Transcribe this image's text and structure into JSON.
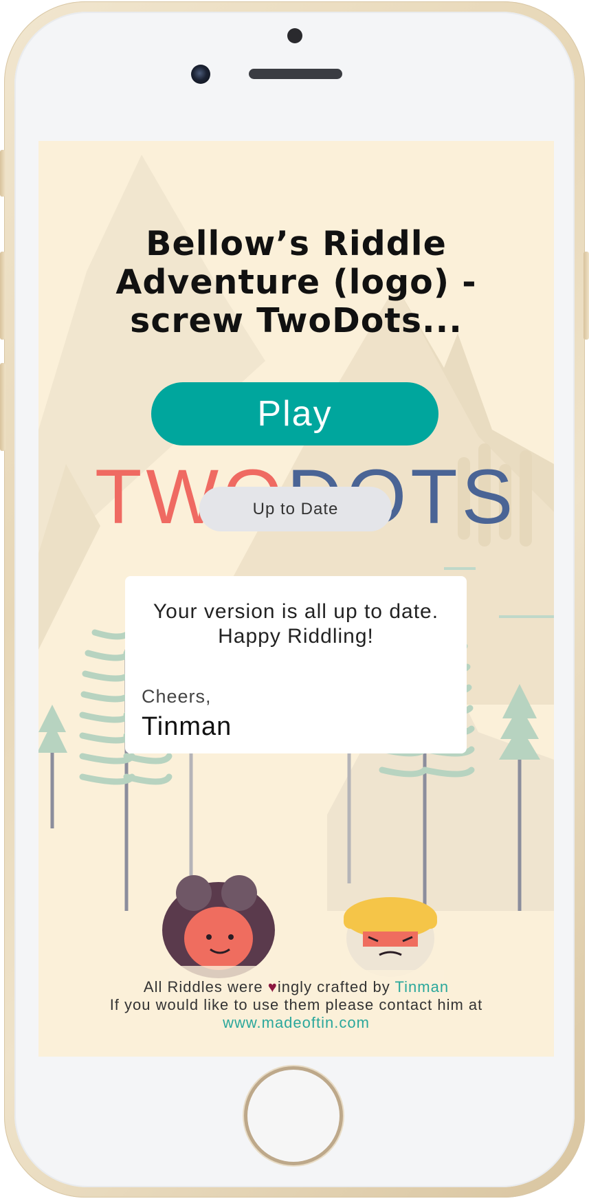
{
  "title": "Bellow’s Riddle Adventure (logo) - screw TwoDots...",
  "play_button": "Play",
  "logo": {
    "part1": "TWO",
    "part2": "DOTS"
  },
  "status_pill": "Up to Date",
  "message_card": {
    "message": "Your version is all up to date. Happy Riddling!",
    "greeting": "Cheers,",
    "signature": "Tinman"
  },
  "footer": {
    "line1_prefix": "All Riddles were ",
    "heart_glyph": "♥",
    "line1_middle": "ingly crafted by ",
    "author_link": "Tinman",
    "line2": "If you would like to use them please contact him at",
    "website_link": "www.madeoftin.com"
  },
  "colors": {
    "accent": "#00a69d",
    "background": "#fbf0d9",
    "logo_red": "#ef6a62",
    "logo_blue": "#4a6495",
    "heart": "#8b1740"
  }
}
